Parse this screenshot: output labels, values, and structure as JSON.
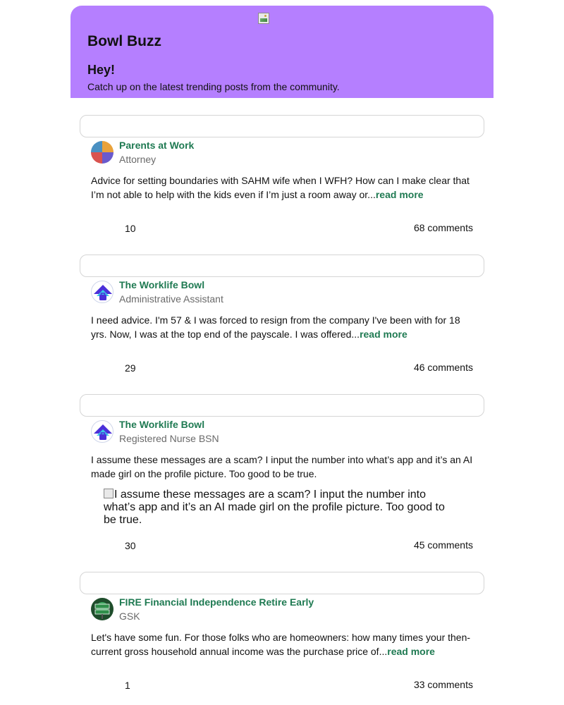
{
  "header": {
    "brand": "Bowl Buzz",
    "greeting": "Hey!",
    "tagline": "Catch up on the latest trending posts from the community.",
    "accent_color": "#b57fff"
  },
  "posts": [
    {
      "bowl": "Parents at Work",
      "role": "Attorney",
      "text": "Advice for setting boundaries with SAHM wife when I WFH? How can I make clear that I’m not able to help with the kids even if I’m just a room away or...",
      "read_more": "read more",
      "likes": "10",
      "comments": "68 comments"
    },
    {
      "bowl": "The Worklife Bowl",
      "role": "Administrative Assistant",
      "text": "I need advice. I'm 57 & I was forced to resign from the company I've been with for 18 yrs. Now, I was at the top end of the payscale. I was offered...",
      "read_more": "read more",
      "likes": "29",
      "comments": "46 comments"
    },
    {
      "bowl": "The Worklife Bowl",
      "role": "Registered Nurse BSN",
      "text": "I assume these messages are a scam? I input the number into what’s app and it’s an AI made girl on the profile picture. Too good to be true.",
      "image_alt": "I assume these messages are a scam? I input the number into what’s app and it’s an AI made girl on the profile picture. Too good to be true.",
      "likes": "30",
      "comments": "45 comments"
    },
    {
      "bowl": "FIRE Financial Independence Retire Early",
      "role": "GSK",
      "text": "Let's have some fun. For those folks who are homeowners: how many times your then-current gross household annual income was the purchase price of...",
      "read_more": "read more",
      "likes": "1",
      "comments": "33 comments"
    }
  ]
}
